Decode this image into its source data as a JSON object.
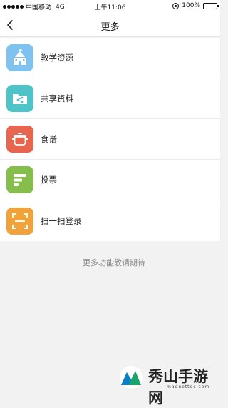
{
  "status_bar": {
    "carrier": "中国移动",
    "network": "4G",
    "time": "上午11:06",
    "battery": "100%"
  },
  "nav": {
    "title": "更多"
  },
  "menu": [
    {
      "label": "教学资源",
      "icon": "school-building-icon",
      "color": "#7ec2ef"
    },
    {
      "label": "共享资料",
      "icon": "share-folder-icon",
      "color": "#4ec3c8"
    },
    {
      "label": "食谱",
      "icon": "cooking-pot-icon",
      "color": "#e8654f"
    },
    {
      "label": "投票",
      "icon": "vote-list-icon",
      "color": "#86be4b"
    },
    {
      "label": "扫一扫登录",
      "icon": "qr-scan-icon",
      "color": "#f2a23a"
    }
  ],
  "footer_text": "更多功能敬请期待",
  "watermark": {
    "title": "秀山手游网",
    "domain": "magnettec.com"
  }
}
